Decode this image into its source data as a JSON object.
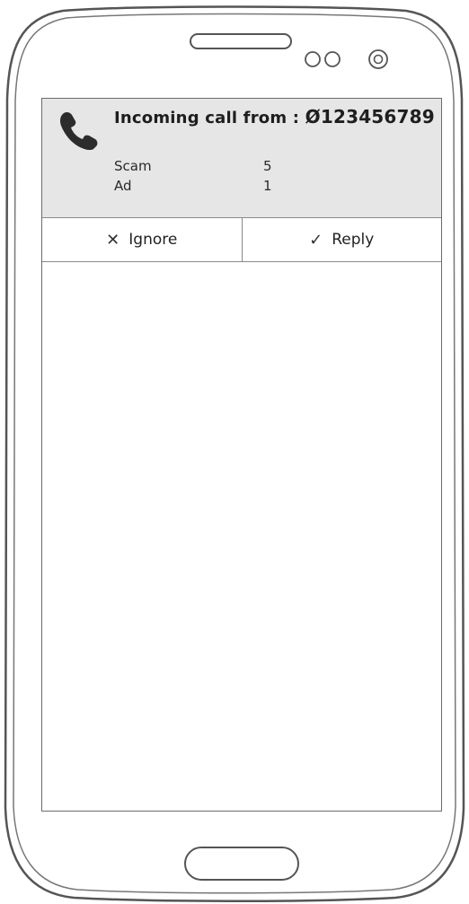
{
  "call": {
    "title_prefix": "Incoming call from :",
    "number": "Ø123456789",
    "icon": "phone-icon"
  },
  "stats": [
    {
      "label": "Scam",
      "value": "5"
    },
    {
      "label": "Ad",
      "value": "1"
    }
  ],
  "actions": {
    "ignore": {
      "icon": "close-icon",
      "glyph": "✕",
      "label": "Ignore"
    },
    "reply": {
      "icon": "check-icon",
      "glyph": "✓",
      "label": "Reply"
    }
  },
  "colors": {
    "notification_bg": "#e6e6e6",
    "border": "#8a8a8a",
    "device_outline": "#555555"
  }
}
